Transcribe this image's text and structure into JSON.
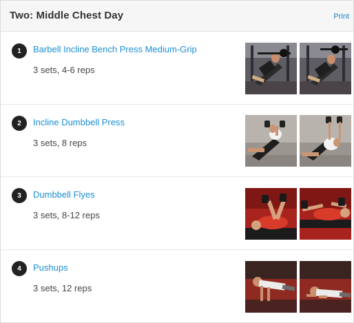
{
  "workout": {
    "title": "Two: Middle Chest Day",
    "print_label": "Print"
  },
  "exercises": [
    {
      "number": "1",
      "name": "Barbell Incline Bench Press Medium-Grip",
      "sets": "3 sets, 4-6 reps"
    },
    {
      "number": "2",
      "name": "Incline Dumbbell Press",
      "sets": "3 sets, 8 reps"
    },
    {
      "number": "3",
      "name": "Dumbbell Flyes",
      "sets": "3 sets, 8-12 reps"
    },
    {
      "number": "4",
      "name": "Pushups",
      "sets": "3 sets, 12 reps"
    }
  ],
  "colors": {
    "link": "#1b8fd6",
    "number_badge": "#222222",
    "header_bg": "#f6f6f6"
  }
}
